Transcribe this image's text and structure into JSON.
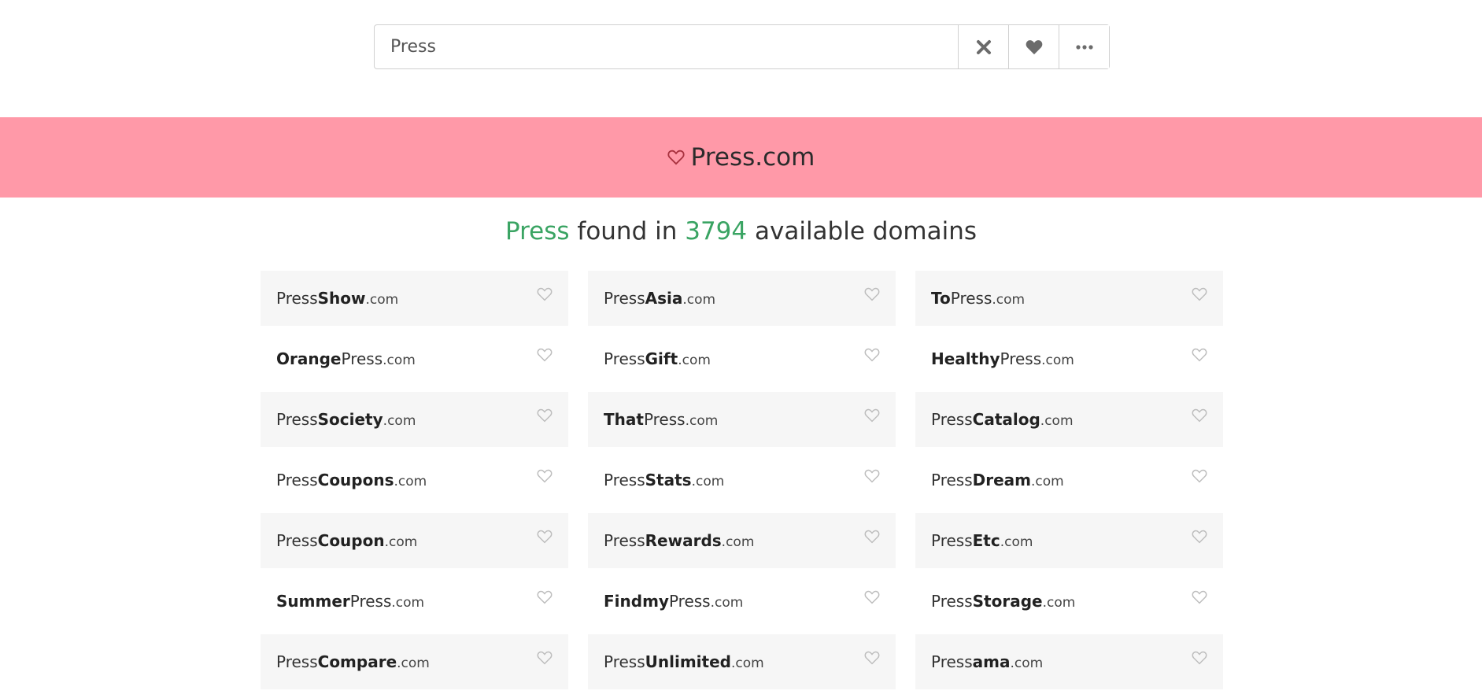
{
  "search": {
    "value": "Press",
    "placeholder": ""
  },
  "toolbar_icons": [
    "close-icon",
    "heart-icon",
    "more-icon"
  ],
  "banner": {
    "icon": "heart-outline-icon",
    "domain": "Press.com",
    "background": "#ff99a8"
  },
  "headline": {
    "keyword": "Press",
    "text1": " found in ",
    "count": "3794",
    "text2": " available domains",
    "accent_color": "#3aa463"
  },
  "results": [
    {
      "plain": "Press",
      "bold": "Show",
      "tld": ".com",
      "order": "plain-bold"
    },
    {
      "plain": "Press",
      "bold": "Asia",
      "tld": ".com",
      "order": "plain-bold"
    },
    {
      "plain": "Press",
      "bold": "To",
      "tld": ".com",
      "order": "bold-plain"
    },
    {
      "plain": "Press",
      "bold": "Orange",
      "tld": ".com",
      "order": "bold-plain"
    },
    {
      "plain": "Press",
      "bold": "Gift",
      "tld": ".com",
      "order": "plain-bold"
    },
    {
      "plain": "Press",
      "bold": "Healthy",
      "tld": ".com",
      "order": "bold-plain"
    },
    {
      "plain": "Press",
      "bold": "Society",
      "tld": ".com",
      "order": "plain-bold"
    },
    {
      "plain": "Press",
      "bold": "That",
      "tld": ".com",
      "order": "bold-plain"
    },
    {
      "plain": "Press",
      "bold": "Catalog",
      "tld": ".com",
      "order": "plain-bold"
    },
    {
      "plain": "Press",
      "bold": "Coupons",
      "tld": ".com",
      "order": "plain-bold"
    },
    {
      "plain": "Press",
      "bold": "Stats",
      "tld": ".com",
      "order": "plain-bold"
    },
    {
      "plain": "Press",
      "bold": "Dream",
      "tld": ".com",
      "order": "plain-bold"
    },
    {
      "plain": "Press",
      "bold": "Coupon",
      "tld": ".com",
      "order": "plain-bold"
    },
    {
      "plain": "Press",
      "bold": "Rewards",
      "tld": ".com",
      "order": "plain-bold"
    },
    {
      "plain": "Press",
      "bold": "Etc",
      "tld": ".com",
      "order": "plain-bold"
    },
    {
      "plain": "Press",
      "bold": "Summer",
      "tld": ".com",
      "order": "bold-plain"
    },
    {
      "plain": "Press",
      "bold": "Findmy",
      "tld": ".com",
      "order": "bold-plain"
    },
    {
      "plain": "Press",
      "bold": "Storage",
      "tld": ".com",
      "order": "plain-bold"
    },
    {
      "plain": "Press",
      "bold": "Compare",
      "tld": ".com",
      "order": "plain-bold"
    },
    {
      "plain": "Press",
      "bold": "Unlimited",
      "tld": ".com",
      "order": "plain-bold"
    },
    {
      "plain": "Press",
      "bold": "ama",
      "tld": ".com",
      "order": "plain-bold"
    }
  ]
}
